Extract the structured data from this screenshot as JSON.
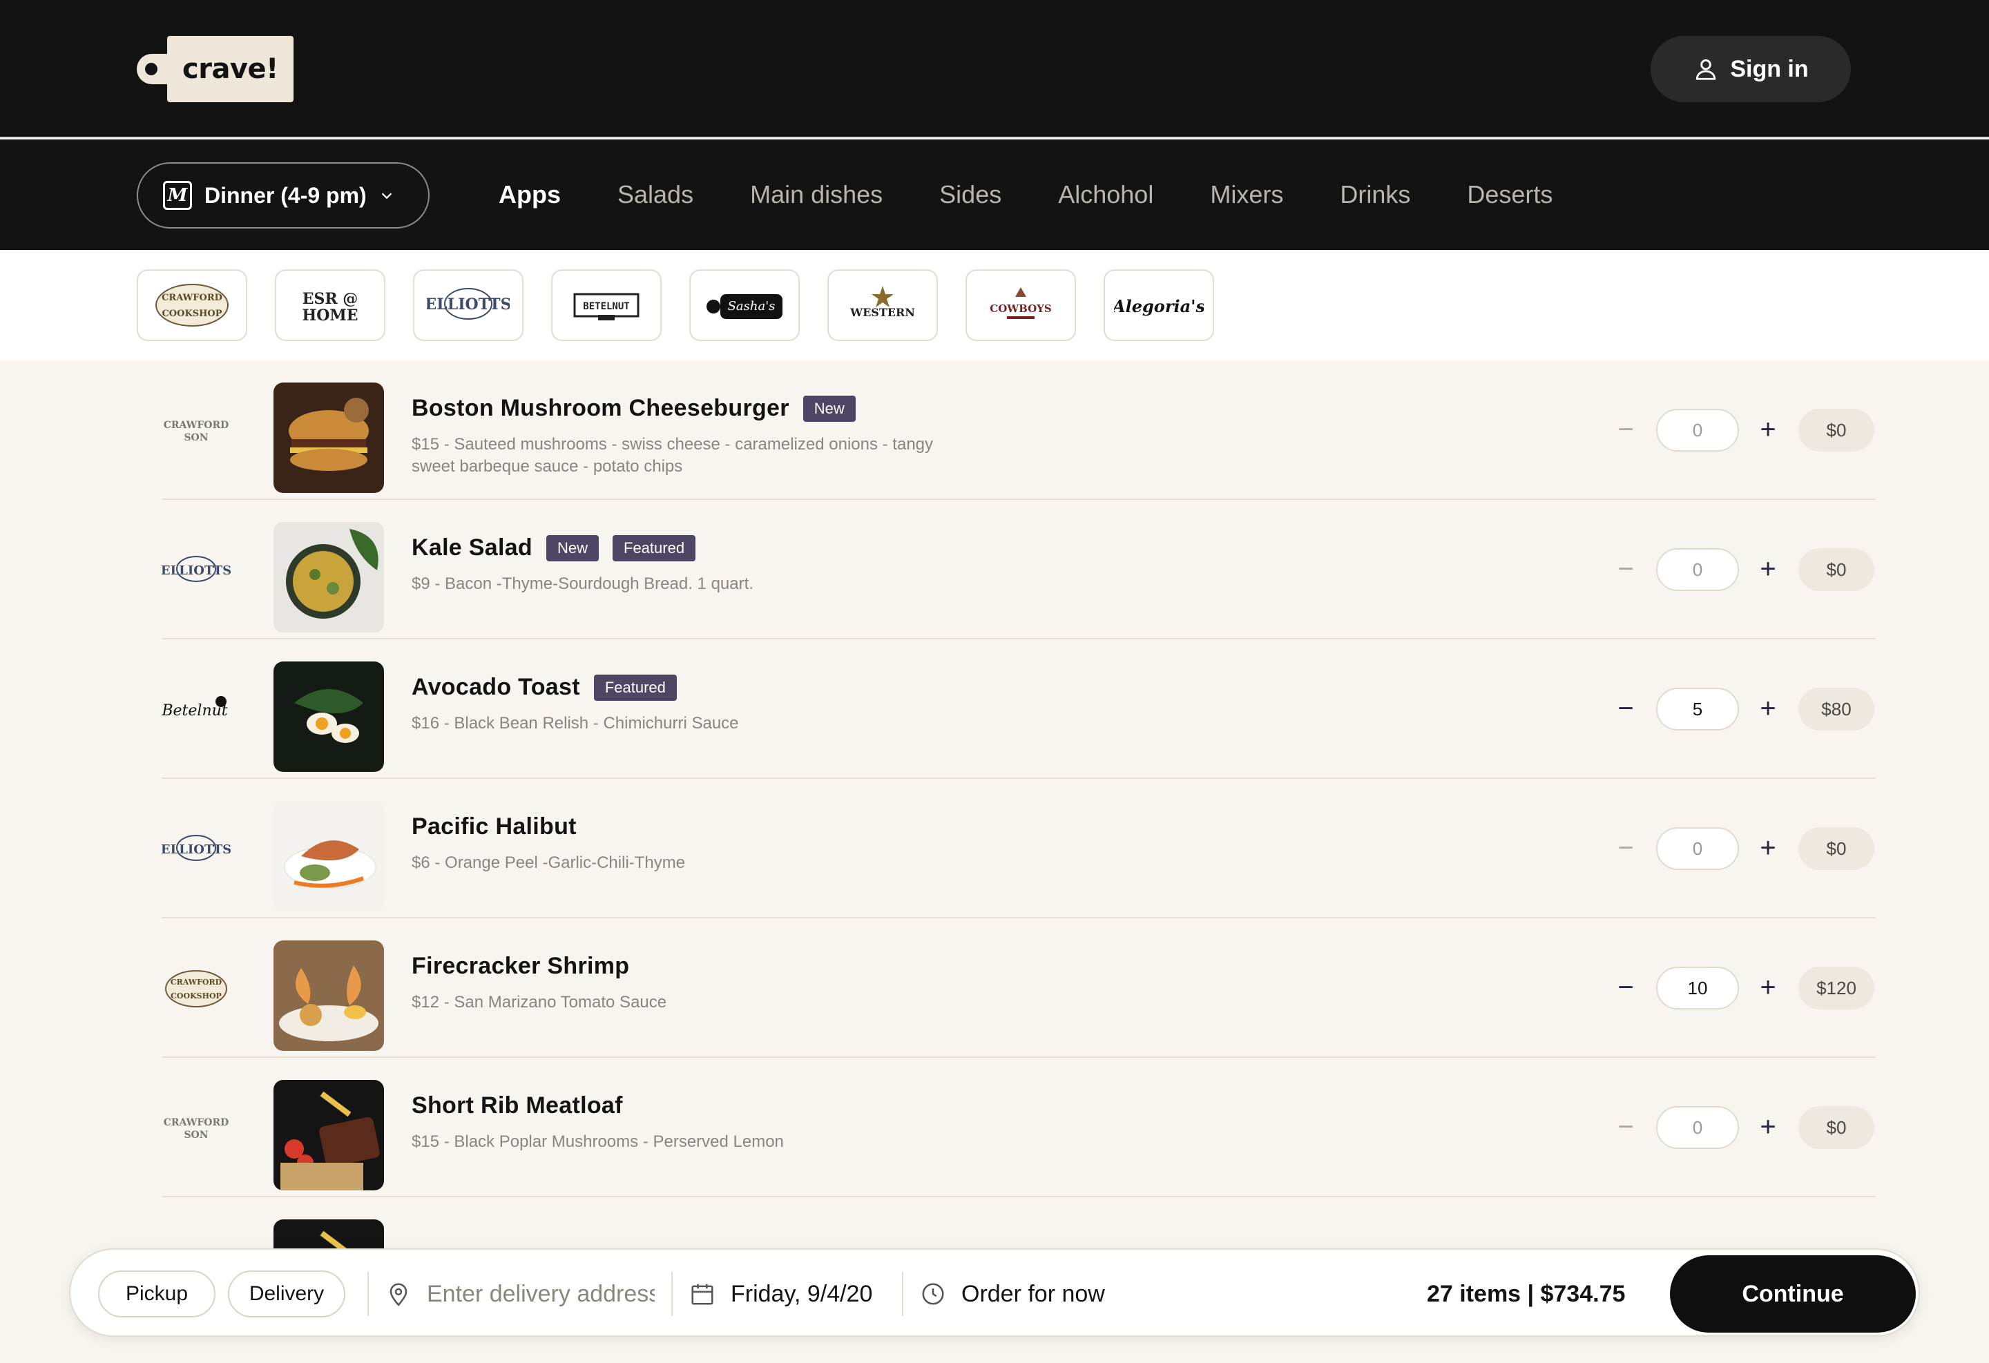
{
  "header": {
    "logo_text": "crave!",
    "signin_label": "Sign in"
  },
  "nav": {
    "menu_select": "Dinner (4-9 pm)",
    "tabs": [
      {
        "label": "Apps",
        "active": true
      },
      {
        "label": "Salads",
        "active": false
      },
      {
        "label": "Main dishes",
        "active": false
      },
      {
        "label": "Sides",
        "active": false
      },
      {
        "label": "Alchohol",
        "active": false
      },
      {
        "label": "Mixers",
        "active": false
      },
      {
        "label": "Drinks",
        "active": false
      },
      {
        "label": "Deserts",
        "active": false
      }
    ]
  },
  "restaurants": [
    {
      "name": "CRAWFORD COOKSHOP"
    },
    {
      "name": "ESR @ HOME"
    },
    {
      "name": "ELLIOTTS"
    },
    {
      "name": "BETELNUT"
    },
    {
      "name": "Sasha's"
    },
    {
      "name": "WESTERN"
    },
    {
      "name": "COWBOYS"
    },
    {
      "name": "Alegoria's"
    }
  ],
  "items": [
    {
      "name": "Boston Mushroom Cheeseburger",
      "badges": [
        "New"
      ],
      "desc": "$15 - Sauteed mushrooms - swiss cheese - caramelized onions - tangy sweet barbeque sauce - potato chips",
      "qty": "0",
      "total": "$0",
      "restaurant": "CRAWFORD SON"
    },
    {
      "name": "Kale Salad",
      "badges": [
        "New",
        "Featured"
      ],
      "desc": "$9 - Bacon -Thyme-Sourdough Bread. 1 quart.",
      "qty": "0",
      "total": "$0",
      "restaurant": "ELLIOTTS"
    },
    {
      "name": "Avocado Toast",
      "badges": [
        "Featured"
      ],
      "desc": "$16 - Black Bean Relish - Chimichurri Sauce",
      "qty": "5",
      "total": "$80",
      "restaurant": "Betelnut"
    },
    {
      "name": "Pacific Halibut",
      "badges": [],
      "desc": "$6 - Orange Peel -Garlic-Chili-Thyme",
      "qty": "0",
      "total": "$0",
      "restaurant": "ELLIOTTS"
    },
    {
      "name": "Firecracker Shrimp",
      "badges": [],
      "desc": "$12 - San Marizano Tomato Sauce",
      "qty": "10",
      "total": "$120",
      "restaurant": "CRAWFORD COOKSHOP"
    },
    {
      "name": "Short Rib Meatloaf",
      "badges": [],
      "desc": "$15 - Black Poplar Mushrooms - Perserved Lemon",
      "qty": "0",
      "total": "$0",
      "restaurant": "CRAWFORD SON"
    }
  ],
  "order_bar": {
    "pickup_label": "Pickup",
    "delivery_label": "Delivery",
    "address_placeholder": "Enter delivery address",
    "date": "Friday, 9/4/20",
    "time": "Order for now",
    "summary": "27 items | $734.75",
    "continue_label": "Continue"
  },
  "colors": {
    "dark": "#141313",
    "badge": "#4f4565",
    "background": "#f8f5f0"
  }
}
